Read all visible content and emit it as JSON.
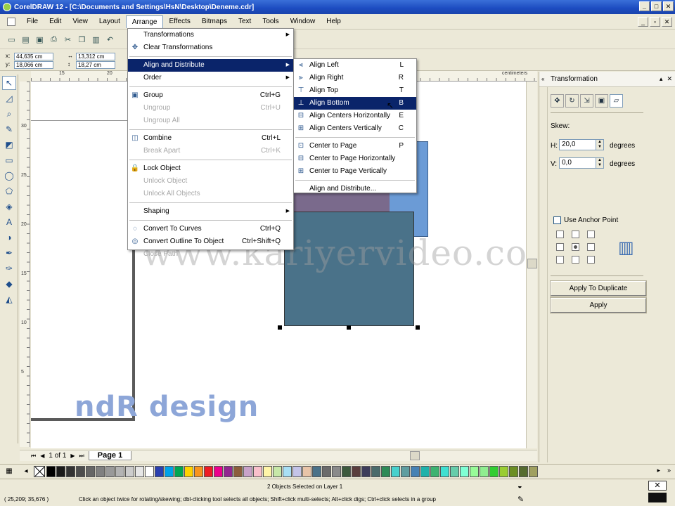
{
  "window": {
    "title": "CorelDRAW 12 - [C:\\Documents and Settings\\HsN\\Desktop\\Deneme.cdr]"
  },
  "menubar": {
    "items": [
      "File",
      "Edit",
      "View",
      "Layout",
      "Arrange",
      "Effects",
      "Bitmaps",
      "Text",
      "Tools",
      "Window",
      "Help"
    ]
  },
  "propbar": {
    "x": "44,635 cm",
    "y": "18,066 cm",
    "w": "13,312 cm",
    "h": "18,27 cm"
  },
  "ruler": {
    "top_nums": [
      "15",
      "20"
    ],
    "top_unit": "centimeters",
    "left_nums": [
      "30",
      "25",
      "20",
      "15",
      "10",
      "5"
    ]
  },
  "arrange_menu": {
    "items": [
      {
        "label": "Transformations",
        "submenu": true
      },
      {
        "label": "Clear Transformations"
      },
      {
        "sep": true
      },
      {
        "label": "Align and Distribute",
        "submenu": true,
        "highlight": true
      },
      {
        "label": "Order",
        "submenu": true
      },
      {
        "sep": true
      },
      {
        "label": "Group",
        "shortcut": "Ctrl+G"
      },
      {
        "label": "Ungroup",
        "shortcut": "Ctrl+U",
        "disabled": true
      },
      {
        "label": "Ungroup All",
        "disabled": true
      },
      {
        "sep": true
      },
      {
        "label": "Combine",
        "shortcut": "Ctrl+L"
      },
      {
        "label": "Break Apart",
        "shortcut": "Ctrl+K",
        "disabled": true
      },
      {
        "sep": true
      },
      {
        "label": "Lock Object"
      },
      {
        "label": "Unlock Object",
        "disabled": true
      },
      {
        "label": "Unlock All Objects",
        "disabled": true
      },
      {
        "sep": true
      },
      {
        "label": "Shaping",
        "submenu": true
      },
      {
        "sep": true
      },
      {
        "label": "Convert To Curves",
        "shortcut": "Ctrl+Q"
      },
      {
        "label": "Convert Outline To Object",
        "shortcut": "Ctrl+Shift+Q"
      },
      {
        "label": "Close Path",
        "disabled": true
      }
    ]
  },
  "align_menu": {
    "items": [
      {
        "label": "Align Left",
        "shortcut": "L"
      },
      {
        "label": "Align Right",
        "shortcut": "R"
      },
      {
        "label": "Align Top",
        "shortcut": "T"
      },
      {
        "label": "Align Bottom",
        "shortcut": "B",
        "highlight": true
      },
      {
        "label": "Align Centers Horizontally",
        "shortcut": "E"
      },
      {
        "label": "Align Centers Vertically",
        "shortcut": "C"
      },
      {
        "sep": true
      },
      {
        "label": "Center to Page",
        "shortcut": "P"
      },
      {
        "label": "Center to Page Horizontally"
      },
      {
        "label": "Center to Page Vertically"
      },
      {
        "sep": true
      },
      {
        "label": "Align and Distribute..."
      }
    ]
  },
  "watermark": {
    "text": "www.kariyervideo.com",
    "brand": "ndR design"
  },
  "pager": {
    "count": "1 of 1",
    "page_tab": "Page 1"
  },
  "docker": {
    "title": "Transformation",
    "skew_label": "Skew:",
    "h_label": "H:",
    "h_value": "20,0",
    "v_label": "V:",
    "v_value": "0,0",
    "unit": "degrees",
    "anchor_label": "Use Anchor Point",
    "apply_dup": "Apply To Duplicate",
    "apply": "Apply"
  },
  "colors": {
    "shape_purple": "#7a6a8c",
    "shape_blue": "#6b9bd6",
    "shape_teal": "#4a7289",
    "menu_highlight": "#0a246a",
    "palette": [
      "#000000",
      "#1a1a1a",
      "#333333",
      "#4d4d4d",
      "#666666",
      "#808080",
      "#999999",
      "#b3b3b3",
      "#cccccc",
      "#e6e6e6",
      "#ffffff",
      "#2a3fb0",
      "#00a2e8",
      "#00a651",
      "#ffd200",
      "#f7941d",
      "#ed1c24",
      "#ec008c",
      "#92278f",
      "#8b5e3c",
      "#c8a2c8",
      "#f9c0cb",
      "#fff5a8",
      "#c7e8a8",
      "#a8dff4",
      "#c4c4e8",
      "#e8c4a8",
      "#4a7289",
      "#6b6b6b",
      "#8a8a8a",
      "#3d5a3d",
      "#5a3d3d",
      "#3d3d5a",
      "#4a6b6b",
      "#2e8b57",
      "#48d1cc",
      "#5f9ea0",
      "#4682b4",
      "#20b2aa",
      "#3cb371",
      "#40e0d0",
      "#66cdaa",
      "#7fffd4",
      "#98fb98",
      "#90ee90",
      "#32cd32",
      "#9acd32",
      "#6b8e23",
      "#556b2f",
      "#a0a060"
    ]
  },
  "status": {
    "selection": "2 Objects Selected on Layer 1",
    "coords": "( 25,209; 35,676 )",
    "hint": "Click an object twice for rotating/skewing; dbl-clicking tool selects all objects; Shift+click multi-selects; Alt+click digs; Ctrl+click selects in a group"
  }
}
